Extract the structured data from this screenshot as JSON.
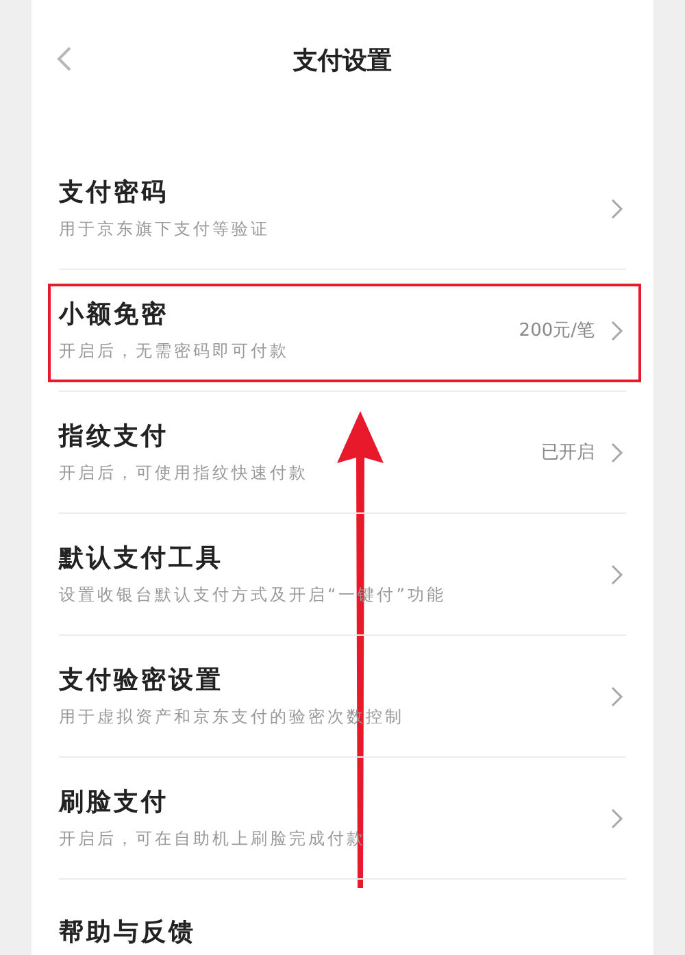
{
  "header": {
    "title": "支付设置"
  },
  "items": [
    {
      "title": "支付密码",
      "subtitle": "用于京东旗下支付等验证",
      "highlighted": false
    },
    {
      "title": "小额免密",
      "subtitle": "开启后，无需密码即可付款",
      "value": "200元/笔",
      "highlighted": true
    },
    {
      "title": "指纹支付",
      "subtitle": "开启后，可使用指纹快速付款",
      "value": "已开启",
      "highlighted": false
    },
    {
      "title": "默认支付工具",
      "subtitle": "设置收银台默认支付方式及开启“一键付”功能",
      "highlighted": false
    },
    {
      "title": "支付验密设置",
      "subtitle": "用于虚拟资产和京东支付的验密次数控制",
      "highlighted": false
    },
    {
      "title": "刷脸支付",
      "subtitle": "开启后，可在自助机上刷脸完成付款",
      "highlighted": false
    },
    {
      "title": "帮助与反馈",
      "highlighted": false
    }
  ]
}
